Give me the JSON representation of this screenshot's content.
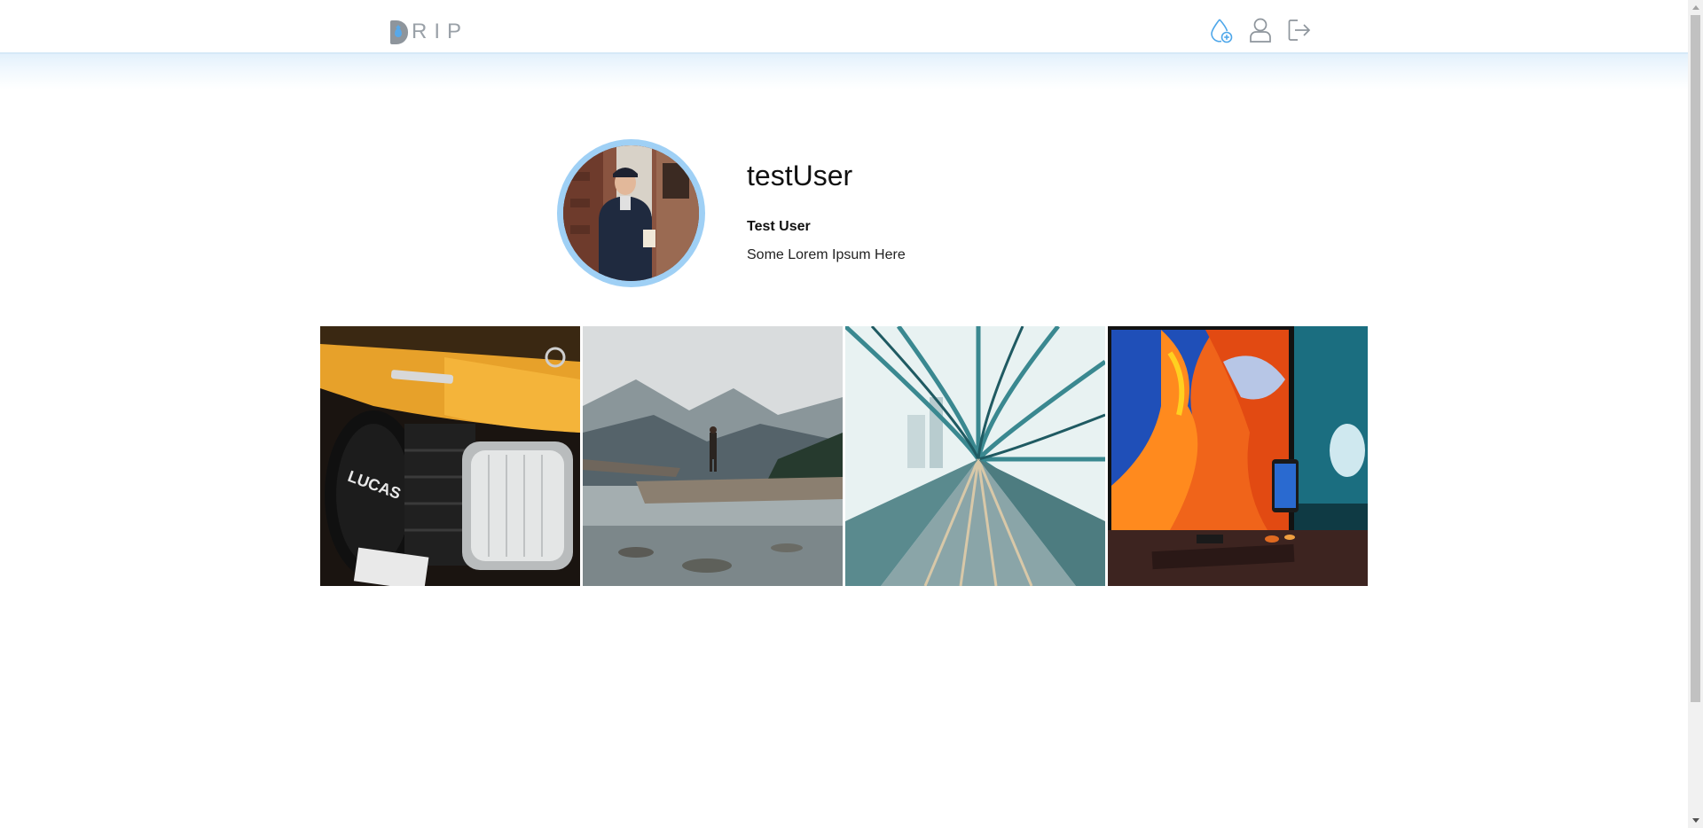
{
  "header": {
    "logo_text": "RIP",
    "icons": [
      "new-drip-icon",
      "profile-icon",
      "logout-icon"
    ],
    "accent_color": "#4ea7ea"
  },
  "profile": {
    "username": "testUser",
    "full_name": "Test User",
    "bio": "Some Lorem Ipsum Here",
    "avatar_ring_color": "#9fd0f5"
  },
  "gallery": {
    "photos": [
      {
        "subject": "yellow-car-headlight"
      },
      {
        "subject": "person-on-log-lake"
      },
      {
        "subject": "light-speed-tunnel"
      },
      {
        "subject": "desk-monitor-setup"
      }
    ]
  }
}
